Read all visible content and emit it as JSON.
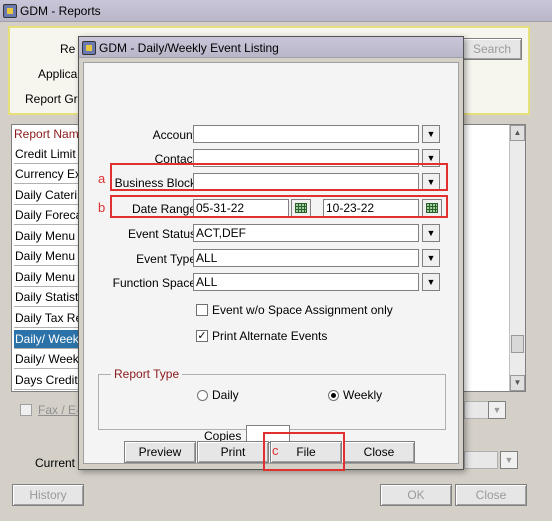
{
  "main_window": {
    "title": "GDM - Reports",
    "search_panel": {
      "labels": [
        "Re",
        "Applica",
        "Report Gr"
      ],
      "search_button": "Search"
    },
    "report_list": {
      "header": "Report Nam",
      "rows": [
        "Credit Limit",
        "Currency Ex",
        "Daily Cateri",
        "Daily Foreca",
        "Daily Menu",
        "Daily Menu",
        "Daily Menu",
        "Daily Statist",
        "Daily Tax Re",
        "Daily/ Week",
        "Daily/ Week",
        "Days Credit"
      ],
      "selected_index": 9
    },
    "bottom": {
      "fax_label": "Fax / E-",
      "current_label": "Current",
      "history_button": "History",
      "ok_button": "OK",
      "close_button": "Close"
    }
  },
  "dialog": {
    "title": "GDM - Daily/Weekly Event Listing",
    "fields": {
      "account": {
        "label": "Account",
        "value": ""
      },
      "contact": {
        "label": "Contact",
        "value": ""
      },
      "business_block": {
        "label": "Business Block",
        "value": ""
      },
      "date_range": {
        "label": "Date Range",
        "from": "05-31-22",
        "to": "10-23-22"
      },
      "event_status": {
        "label": "Event Status",
        "value": "ACT,DEF"
      },
      "event_type": {
        "label": "Event Type",
        "value": "ALL"
      },
      "function_space": {
        "label": "Function Space",
        "value": "ALL"
      }
    },
    "checkboxes": {
      "no_space": {
        "label": "Event w/o Space Assignment only",
        "checked": false
      },
      "print_alternate": {
        "label": "Print Alternate Events",
        "checked": true
      }
    },
    "report_type": {
      "legend": "Report Type",
      "daily": "Daily",
      "weekly": "Weekly",
      "selected": "Weekly"
    },
    "copies": {
      "label": "Copies",
      "value": ""
    },
    "buttons": {
      "preview": "Preview",
      "print": "Print",
      "file": "File",
      "close": "Close"
    }
  },
  "annotations": {
    "a": "a",
    "b": "b",
    "c": "c",
    "color": "#e03030"
  },
  "icons": {
    "dropdown": "▼",
    "check": "✓",
    "scroll_up": "▲",
    "scroll_down": "▼"
  }
}
